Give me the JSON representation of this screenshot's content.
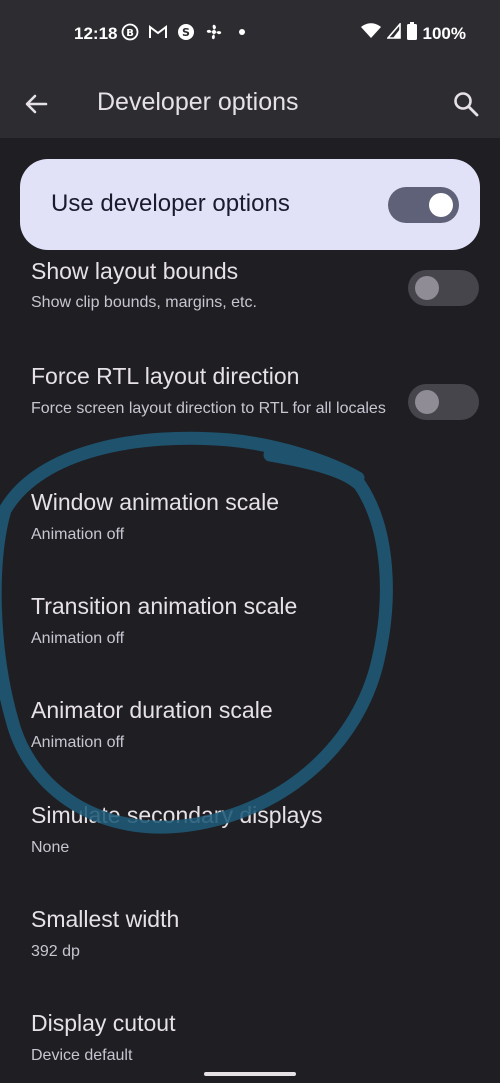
{
  "status_bar": {
    "time": "12:18",
    "notification_icons": [
      "b-circle-icon",
      "gmail-icon",
      "s-circle-icon",
      "fan-icon",
      "dot-icon"
    ],
    "battery": "100%"
  },
  "app_bar": {
    "title": "Developer options"
  },
  "master_switch": {
    "label": "Use developer options",
    "state": "on"
  },
  "settings": [
    {
      "title": "Show layout bounds",
      "summary": "Show clip bounds, margins, etc.",
      "toggle": "off"
    },
    {
      "title": "Force RTL layout direction",
      "summary": "Force screen layout direction to RTL for all locales",
      "toggle": "off"
    },
    {
      "title": "Window animation scale",
      "summary": "Animation off"
    },
    {
      "title": "Transition animation scale",
      "summary": "Animation off"
    },
    {
      "title": "Animator duration scale",
      "summary": "Animation off"
    },
    {
      "title": "Simulate secondary displays",
      "summary": "None"
    },
    {
      "title": "Smallest width",
      "summary": "392 dp"
    },
    {
      "title": "Display cutout",
      "summary": "Device default"
    }
  ],
  "colors": {
    "background": "#1f1e23",
    "app_bar": "#2d2c31",
    "master_card": "#e1e2f8",
    "annotation_stroke": "#1f5a78"
  }
}
